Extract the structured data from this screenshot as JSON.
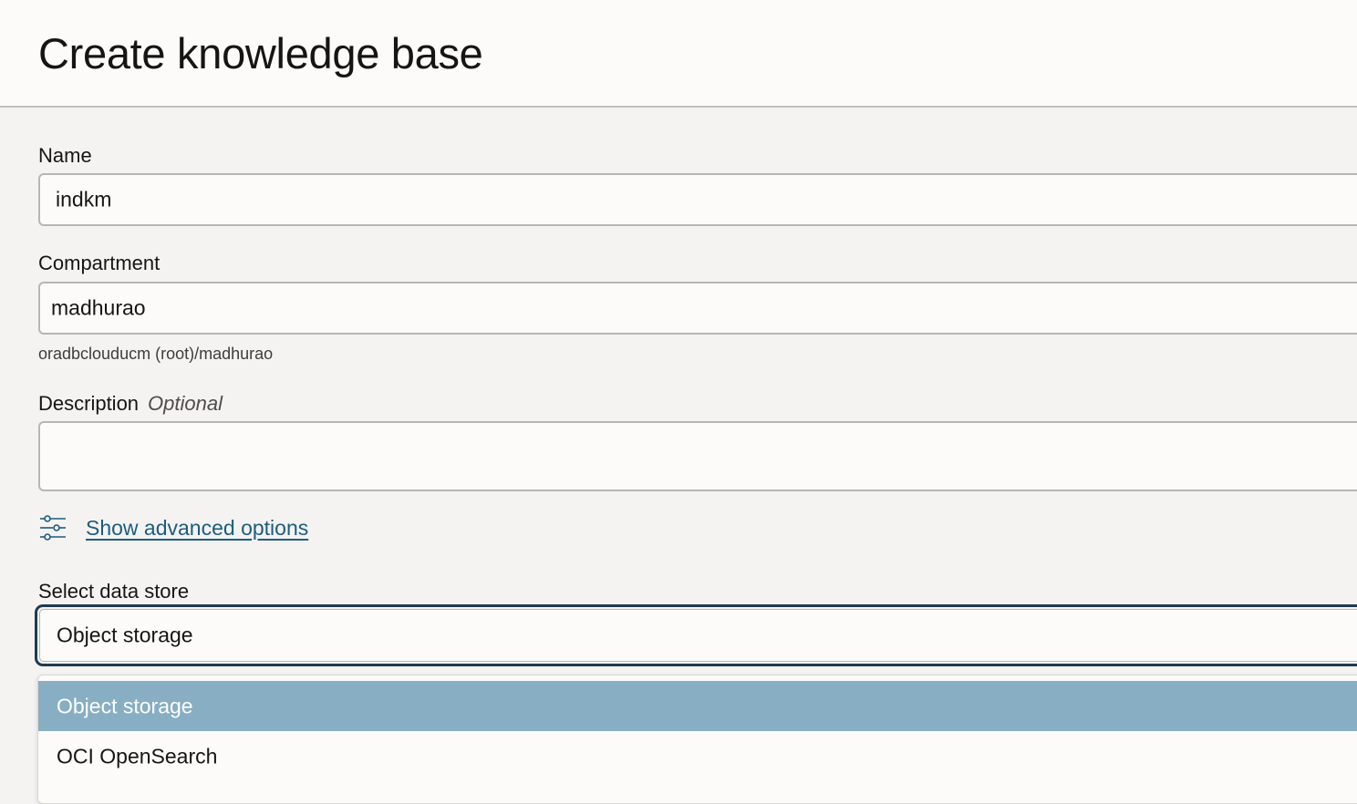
{
  "header": {
    "title": "Create knowledge base"
  },
  "form": {
    "name": {
      "label": "Name",
      "value": "indkm"
    },
    "compartment": {
      "label": "Compartment",
      "value": "madhurao",
      "path": "oradbclouducm (root)/madhurao"
    },
    "description": {
      "label": "Description",
      "optional": "Optional",
      "value": ""
    },
    "advanced": {
      "icon": "sliders-icon",
      "label": "Show advanced options"
    },
    "data_store": {
      "label": "Select data store",
      "selected": "Object storage",
      "options": [
        {
          "label": "Object storage",
          "highlighted": true
        },
        {
          "label": "OCI OpenSearch",
          "highlighted": false
        }
      ]
    }
  },
  "colors": {
    "link": "#1c5d80",
    "focus_border": "#1f3a52",
    "option_highlight": "#87aec3",
    "page_bg": "#f4f3f2"
  }
}
